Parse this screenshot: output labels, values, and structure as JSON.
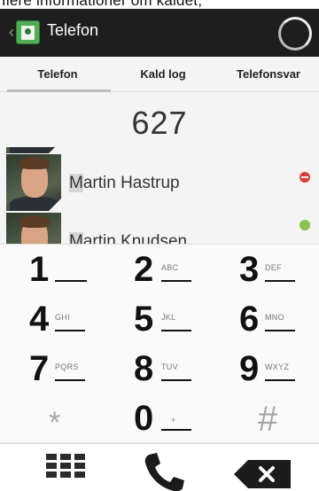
{
  "top_text": "flere informationer om kaldet,",
  "app": {
    "title": "Telefon",
    "icon": "contacts-book-icon",
    "loading_icon": "spinner-icon"
  },
  "tabs": [
    {
      "label": "Telefon",
      "selected": true
    },
    {
      "label": "Kald log",
      "selected": false
    },
    {
      "label": "Telefonsvar",
      "selected": false
    }
  ],
  "dialed_number": "627",
  "contacts": [
    {
      "name": "Martin Hastrup",
      "match": "M",
      "status": "busy",
      "status_color": "#e53935"
    },
    {
      "name": "Martin Knudsen",
      "match": "M",
      "status": "online",
      "status_color": "#8bc34a"
    }
  ],
  "keys": [
    {
      "digit": "1",
      "letters": ""
    },
    {
      "digit": "2",
      "letters": "ABC"
    },
    {
      "digit": "3",
      "letters": "DEF"
    },
    {
      "digit": "4",
      "letters": "GHI"
    },
    {
      "digit": "5",
      "letters": "JKL"
    },
    {
      "digit": "6",
      "letters": "MNO"
    },
    {
      "digit": "7",
      "letters": "PQRS"
    },
    {
      "digit": "8",
      "letters": "TUV"
    },
    {
      "digit": "9",
      "letters": "WXYZ"
    },
    {
      "digit": "*",
      "letters": ""
    },
    {
      "digit": "0",
      "letters": "+"
    },
    {
      "digit": "#",
      "letters": ""
    }
  ],
  "bottom_bar": {
    "left_icon": "hide-keypad-icon",
    "center_icon": "phone-call-icon",
    "right_icon": "backspace-icon"
  }
}
